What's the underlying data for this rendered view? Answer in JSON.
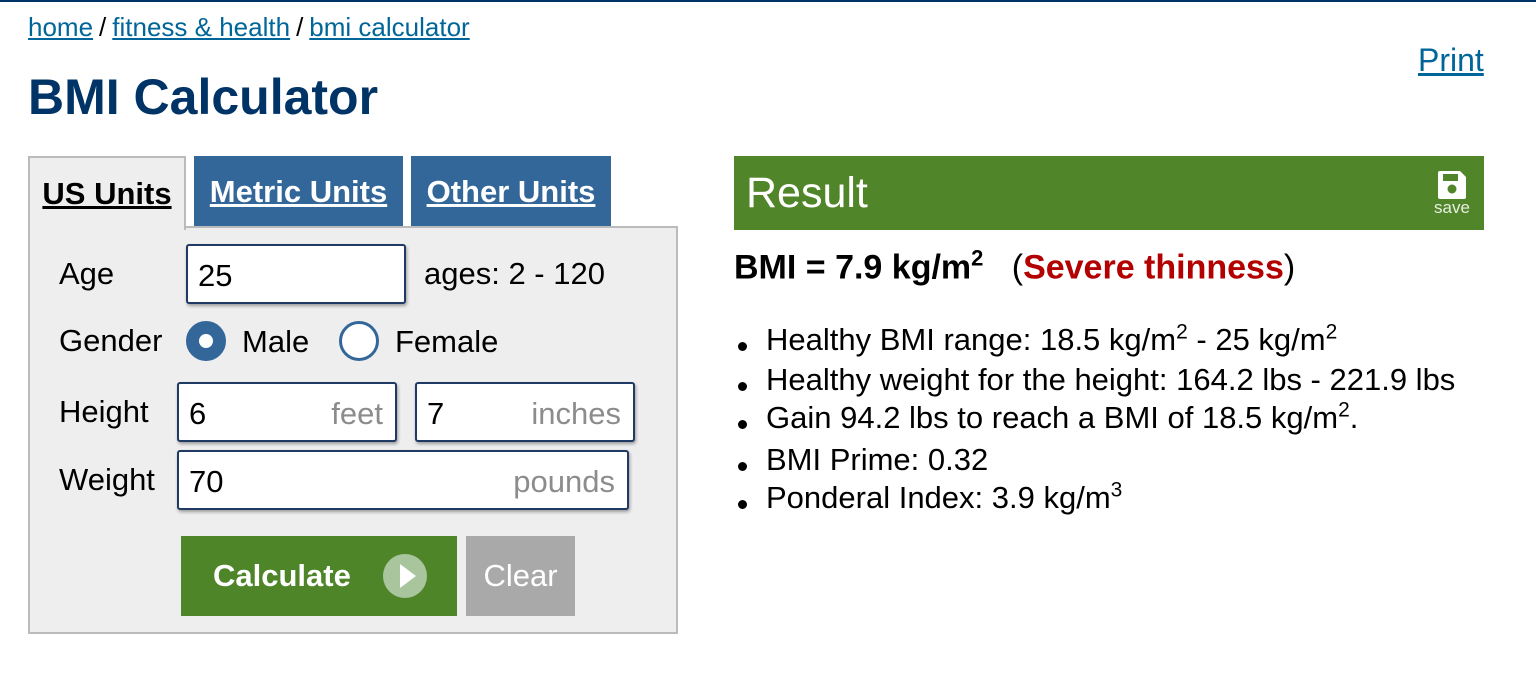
{
  "breadcrumb": {
    "items": [
      "home",
      "fitness & health",
      "bmi calculator"
    ],
    "separator": "/"
  },
  "page": {
    "title": "BMI Calculator",
    "print_label": "Print"
  },
  "tabs": [
    {
      "label": "US Units",
      "active": true
    },
    {
      "label": "Metric Units",
      "active": false
    },
    {
      "label": "Other Units",
      "active": false
    }
  ],
  "form": {
    "age": {
      "label": "Age",
      "value": "25",
      "hint": "ages: 2 - 120"
    },
    "gender": {
      "label": "Gender",
      "options": [
        "Male",
        "Female"
      ],
      "selected": "Male"
    },
    "height": {
      "label": "Height",
      "feet": "6",
      "feet_unit": "feet",
      "inches": "7",
      "inches_unit": "inches"
    },
    "weight": {
      "label": "Weight",
      "value": "70",
      "unit": "pounds"
    },
    "calculate_label": "Calculate",
    "clear_label": "Clear"
  },
  "result": {
    "heading": "Result",
    "save_label": "save",
    "bmi_prefix": "BMI = 7.9 kg/m",
    "bmi_sup": "2",
    "category": "Severe thinness",
    "facts": {
      "range_prefix": "Healthy BMI range: 18.5 kg/m",
      "range_mid": " - 25 kg/m",
      "sup2": "2",
      "weight_range": "Healthy weight for the height: 164.2 lbs - 221.9 lbs",
      "gain_prefix": "Gain 94.2 lbs to reach a BMI of 18.5 kg/m",
      "gain_suffix": ".",
      "prime": "BMI Prime: 0.32",
      "ponderal_prefix": "Ponderal Index: 3.9 kg/m",
      "sup3": "3"
    }
  },
  "colors": {
    "title": "#003366",
    "tab_inactive": "#336699",
    "result_bar": "#518529",
    "calculate_button": "#4e8529",
    "clear_button": "#a9a9a9",
    "category_text": "#b30000",
    "link": "#006699"
  }
}
